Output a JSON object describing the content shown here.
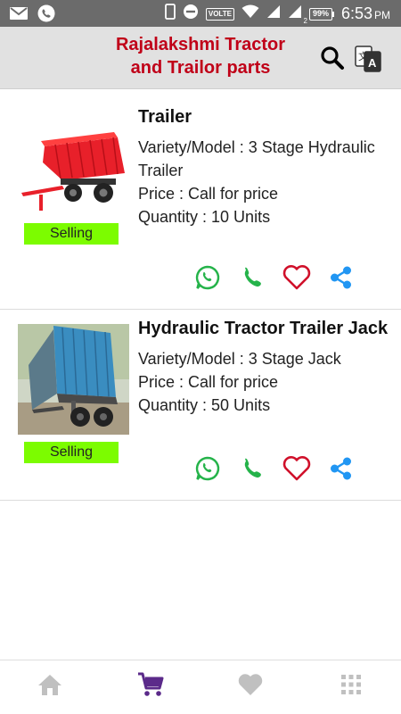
{
  "status_bar": {
    "time": "6:53",
    "ampm": "PM",
    "network_label": "VOLTE",
    "sim_index": "2",
    "battery": "99%",
    "icons": [
      "gmail-icon",
      "phone-call-icon",
      "phone-device-icon",
      "do-not-disturb-icon",
      "wifi-icon",
      "signal-icon",
      "signal-2-icon",
      "battery-icon"
    ]
  },
  "header": {
    "title_line1": "Rajalakshmi Tractor",
    "title_line2": "and Trailor parts",
    "title_color": "#c00018",
    "icons": [
      "search-icon",
      "translate-icon"
    ]
  },
  "products": [
    {
      "name": "Trailer",
      "variety": "Variety/Model : 3 Stage Hydraulic Trailer",
      "price": "Price : Call for price",
      "quantity": "Quantity : 10 Units",
      "badge": "Selling",
      "image": "red-tipping-trailer-image"
    },
    {
      "name": "Hydraulic Tractor Trailer Jack",
      "variety": "Variety/Model : 3 Stage Jack",
      "price": "Price : Call for price",
      "quantity": "Quantity : 50 Units",
      "badge": "Selling",
      "image": "blue-tipping-trailer-image"
    }
  ],
  "actions": [
    "whatsapp-icon",
    "phone-icon",
    "heart-icon",
    "share-icon"
  ],
  "colors": {
    "whatsapp": "#25b34a",
    "phone": "#25b34a",
    "heart": "#d0102a",
    "share": "#2196f3",
    "badge_bg": "#7cfc00",
    "nav_active": "#5b2a8a",
    "nav_inactive": "#c0c0c0"
  },
  "bottom_nav": [
    {
      "icon": "home-icon",
      "active": false
    },
    {
      "icon": "cart-icon",
      "active": true
    },
    {
      "icon": "favorites-heart-icon",
      "active": false
    },
    {
      "icon": "grid-menu-icon",
      "active": false
    }
  ]
}
